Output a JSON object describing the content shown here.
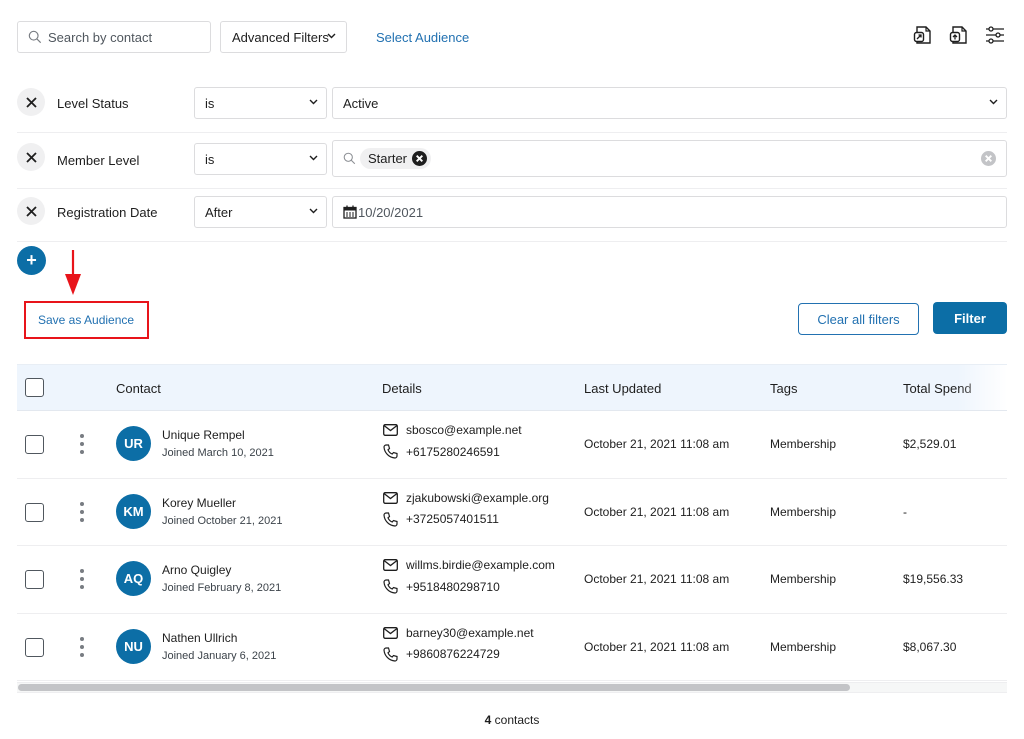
{
  "toolbar": {
    "search_placeholder": "Search by contact",
    "advanced_filters_label": "Advanced Filters",
    "select_audience_label": "Select Audience",
    "icons": [
      "export-icon",
      "import-icon",
      "settings-sliders-icon"
    ]
  },
  "filters": [
    {
      "field": "Level Status",
      "operator": "is",
      "value": "Active",
      "value_type": "select"
    },
    {
      "field": "Member Level",
      "operator": "is",
      "value_chips": [
        "Starter"
      ],
      "value_type": "tags"
    },
    {
      "field": "Registration Date",
      "operator": "After",
      "value": "10/20/2021",
      "value_type": "date"
    }
  ],
  "actions": {
    "add_filter_label": "+",
    "save_audience_label": "Save as Audience",
    "clear_all_label": "Clear all filters",
    "filter_label": "Filter"
  },
  "table": {
    "columns": [
      "Contact",
      "Details",
      "Last Updated",
      "Tags",
      "Total Spend"
    ],
    "rows": [
      {
        "initials": "UR",
        "name": "Unique Rempel",
        "joined": "Joined March 10, 2021",
        "email": "sbosco@example.net",
        "phone": "+6175280246591",
        "updated": "October 21, 2021 11:08 am",
        "tags": "Membership",
        "spend": "$2,529.01"
      },
      {
        "initials": "KM",
        "name": "Korey Mueller",
        "joined": "Joined October 21, 2021",
        "email": "zjakubowski@example.org",
        "phone": "+3725057401511",
        "updated": "October 21, 2021 11:08 am",
        "tags": "Membership",
        "spend": "-"
      },
      {
        "initials": "AQ",
        "name": "Arno Quigley",
        "joined": "Joined February 8, 2021",
        "email": "willms.birdie@example.com",
        "phone": "+9518480298710",
        "updated": "October 21, 2021 11:08 am",
        "tags": "Membership",
        "spend": "$19,556.33"
      },
      {
        "initials": "NU",
        "name": "Nathen Ullrich",
        "joined": "Joined January 6, 2021",
        "email": "barney30@example.net",
        "phone": "+9860876224729",
        "updated": "October 21, 2021 11:08 am",
        "tags": "Membership",
        "spend": "$8,067.30"
      }
    ],
    "horizontal_scroll_fraction": 0.84
  },
  "footer": {
    "count": "4",
    "count_label": " contacts"
  },
  "colors": {
    "accent": "#2271b1",
    "primary_button": "#0c6ea6",
    "annotation_red": "#e8141a",
    "header_bg": "#eef5fd"
  }
}
